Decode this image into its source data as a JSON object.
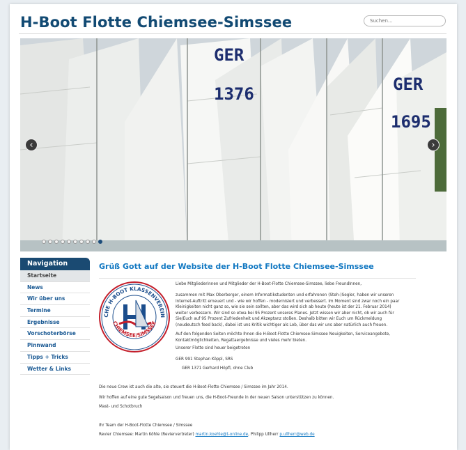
{
  "header": {
    "title": "H-Boot Flotte Chiemsee-Simssee",
    "search_placeholder": "Suchen..."
  },
  "slider": {
    "prev_label": "‹",
    "next_label": "›",
    "slide_count": 10,
    "active_slide": 10,
    "sail_numbers": [
      "GER",
      "1376",
      "GER",
      "1695"
    ]
  },
  "sidebar": {
    "heading": "Navigation",
    "items": [
      {
        "label": "Startseite",
        "active": true
      },
      {
        "label": "News"
      },
      {
        "label": "Wir über uns"
      },
      {
        "label": "Termine"
      },
      {
        "label": "Ergebnisse"
      },
      {
        "label": "Vorschoterbörse"
      },
      {
        "label": "Pinnwand"
      },
      {
        "label": "Tipps + Tricks"
      },
      {
        "label": "Wetter & Links"
      }
    ]
  },
  "logo": {
    "text_top": "DEUTSCHE H-BOOT KLASSENVEREINIGUNG",
    "text_bottom": "CHIEMSEE/SIMSSEE",
    "colors": {
      "red": "#c41f2b",
      "blue": "#1b4d8c"
    }
  },
  "content": {
    "title": "Grüß Gott auf der Website der H-Boot Flotte Chiemsee-Simssee",
    "intro_lines": [
      "Liebe Mitgliederinnen und Mitglieder der H-Boot-Flotte Chiemsee-Simssee, liebe FreundInnen,",
      "zusammen mit Max Oberberger, einem  Informatikstudenten und erfahrenen (Steh-)Segler, haben wir unseren",
      "Internet-Auftritt erneuert und - wie wir hoffen - modernisiert und verbessert. Im Moment sind zwar noch ein paar",
      "Kleinigkeiten nicht ganz so, wie sie sein sollten, aber das wird sich ab heute (heute ist der 21. Februar 2014)",
      "weiter verbessern. Wir sind so etwa bei 95 Prozent unseres Planes. Jetzt wissen wir aber nicht, ob wir auch für",
      "Sie/Euch auf 95 Prozent Zufriedenheit und Akzeptanz stoßen. Deshalb bitten wir Euch um Rückmeldung",
      "(neudeutsch feed back), dabei ist uns Kritik wichtiger als Lob, über das wir uns aber natürlich auch freuen."
    ],
    "para2_lines": [
      "Auf den folgenden Seiten möchte Ihnen die H-Boot-Flotte Chiemsee-Simssee Neuigkeiten, Serviceangebote,",
      "Kontaktmöglichkeiten, Regattaergebnisse und vieles mehr bieten."
    ],
    "fleet_intro": "Unserer Flotte sind heuer beigetreten",
    "boat1": "GER   991 Stephan Köppl, SRS",
    "boat2": "GER 1371 Gerhard Höpfl, ohne Club",
    "crew_line": " Die neue Crew ist auch die alte, sie steuert die H-Boot-Flotte Chiemsee  / Simssee im Jahr 2014.",
    "hope_line": "Wir hoffen auf eine gute Segelsaison und freuen  uns, die H-Boot-Freunde in der neuen Saison unterstützen zu können.",
    "mast_line": "Mast- und Schotbruch",
    "team_line": "Ihr Team der H-Boot-Flotte Chiemsee  / Simssee",
    "revier_prefix": "Revier Chiemsee: Martin Köhle (Reviervertreter) ",
    "revier_email1": "martin.koehle@t-online.de",
    "revier_mid": ", Philipp Ullherr ",
    "revier_email2": "p.ullherr@web.de"
  }
}
